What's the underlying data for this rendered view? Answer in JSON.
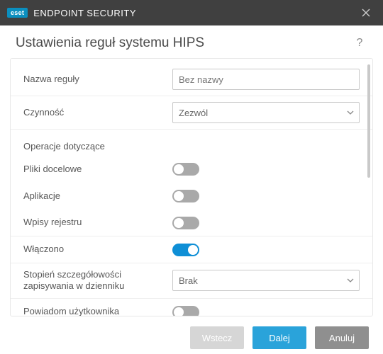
{
  "titlebar": {
    "brand": "eset",
    "product": "ENDPOINT SECURITY"
  },
  "header": {
    "title": "Ustawienia reguł systemu HIPS"
  },
  "form": {
    "rule_name_label": "Nazwa reguły",
    "rule_name_placeholder": "Bez nazwy",
    "rule_name_value": "",
    "action_label": "Czynność",
    "action_value": "Zezwól",
    "operations_section": "Operacje dotyczące",
    "target_files_label": "Pliki docelowe",
    "applications_label": "Aplikacje",
    "registry_entries_label": "Wpisy rejestru",
    "enabled_label": "Włączono",
    "log_level_label": "Stopień szczegółowości zapisywania w dzienniku",
    "log_level_value": "Brak",
    "notify_user_label": "Powiadom użytkownika"
  },
  "toggles": {
    "target_files": false,
    "applications": false,
    "registry_entries": false,
    "enabled": true,
    "notify_user": false
  },
  "footer": {
    "back": "Wstecz",
    "next": "Dalej",
    "cancel": "Anuluj"
  }
}
